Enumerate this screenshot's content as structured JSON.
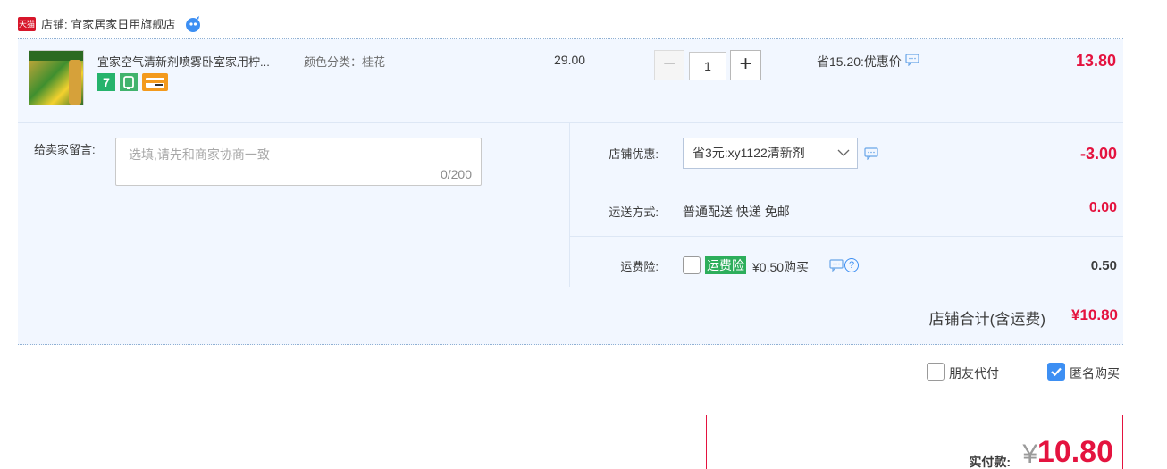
{
  "shop": {
    "logo_text": "天猫",
    "label": "店铺: 宜家居家日用旗舰店",
    "icon": "wangwang-chat-icon"
  },
  "item": {
    "title": "宜家空气清新剂喷雾卧室家用柠...",
    "sku": "颜色分类：桂花",
    "badge_7": "7",
    "unit_price": "29.00",
    "quantity": "1",
    "minus_label": "−",
    "plus_label": "+",
    "discount_label": "省15.20:优惠价",
    "total": "13.80"
  },
  "message": {
    "label": "给卖家留言:",
    "placeholder": "选填,请先和商家协商一致",
    "counter": "0/200"
  },
  "options": {
    "coupon_label": "店铺优惠:",
    "coupon_value": "省3元:xy1122清新剂",
    "coupon_amount": "-3.00",
    "shipping_label": "运送方式:",
    "shipping_value": "普通配送 快递 免邮",
    "shipping_amount": "0.00",
    "insurance_label": "运费险:",
    "insurance_tag": "运费险",
    "insurance_value": "¥0.50购买",
    "insurance_amount": "0.50"
  },
  "shop_total": {
    "label": "店铺合计(含运费)",
    "value": "¥10.80"
  },
  "extras": {
    "friend_pay": "朋友代付",
    "anonymous": "匿名购买",
    "anonymous_checked": true
  },
  "payment": {
    "label": "实付款:",
    "currency": "¥",
    "amount": "10.80"
  },
  "colors": {
    "price_red": "#e4133f",
    "panel_bg": "#f2f7ff",
    "accent_blue": "#3d8ff3",
    "insurance_green": "#2dae5b"
  }
}
